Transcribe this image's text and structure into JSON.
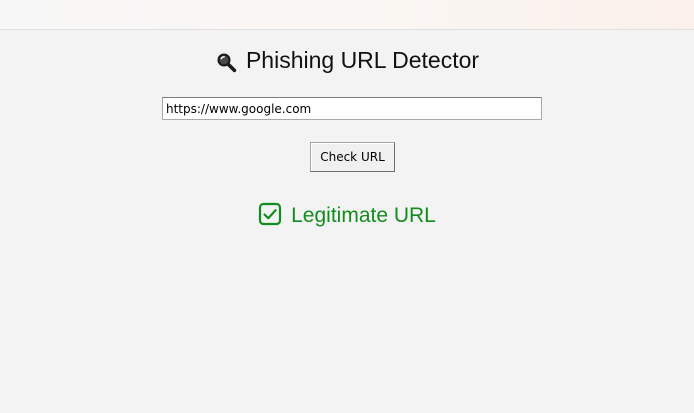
{
  "window": {
    "heading_icon": "magnifier-icon",
    "heading": "Phishing URL Detector"
  },
  "form": {
    "url_value": "https://www.google.com",
    "check_button_label": "Check URL"
  },
  "result": {
    "icon": "checkbox-check-icon",
    "text": "Legitimate URL",
    "color": "#138c1f"
  }
}
